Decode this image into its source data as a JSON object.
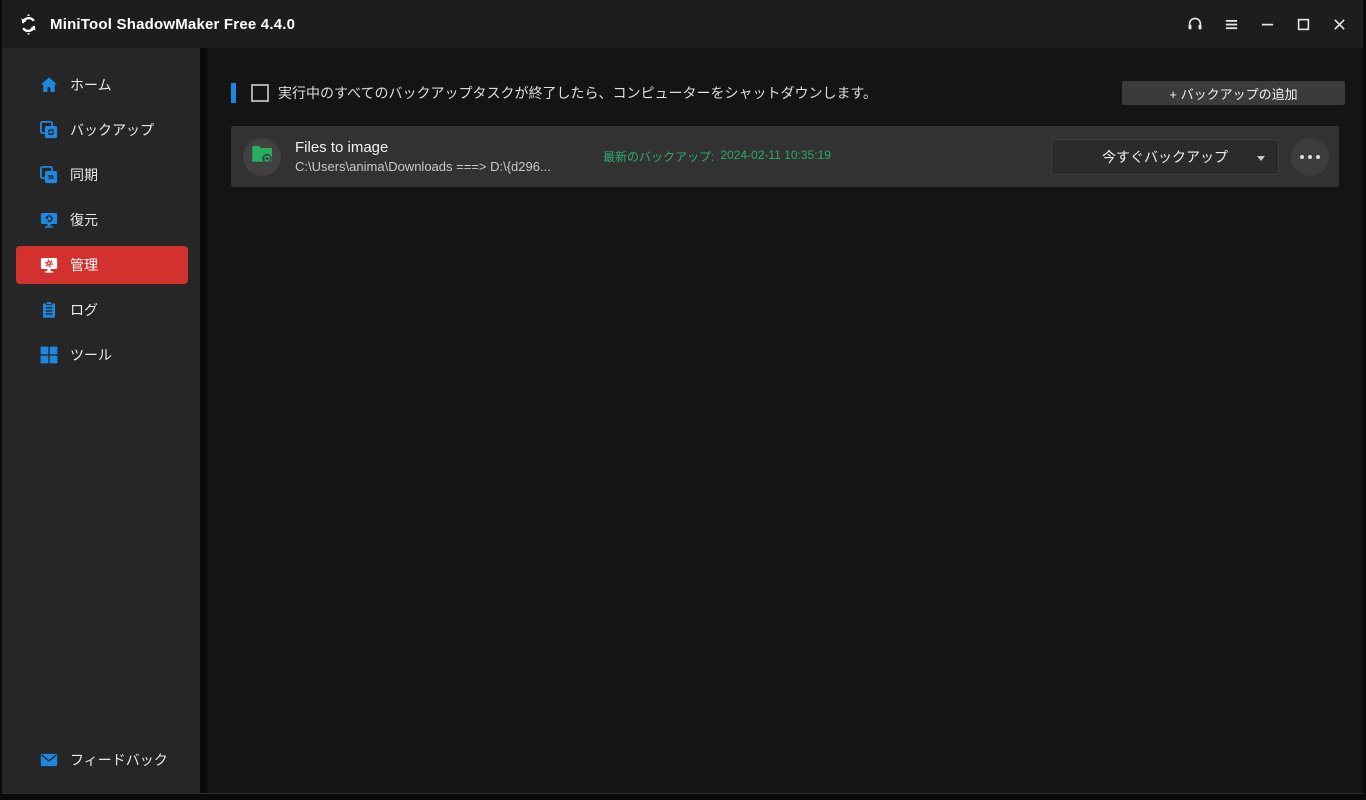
{
  "window": {
    "title": "MiniTool ShadowMaker Free 4.4.0",
    "controls": [
      {
        "name": "support-icon"
      },
      {
        "name": "menu-icon"
      },
      {
        "name": "minimize-icon"
      },
      {
        "name": "maximize-icon"
      },
      {
        "name": "close-icon"
      }
    ]
  },
  "colors": {
    "accent_blue": "#1b87e5",
    "icon_blue": "#1e87e0",
    "selected_red": "#d3312e",
    "success_green": "#27ae60",
    "card_bg": "#323232"
  },
  "sidebar": {
    "items": [
      {
        "label": "ホーム",
        "icon": "home-icon",
        "selected": false
      },
      {
        "label": "バックアップ",
        "icon": "backup-icon",
        "selected": false
      },
      {
        "label": "同期",
        "icon": "sync-icon",
        "selected": false
      },
      {
        "label": "復元",
        "icon": "restore-icon",
        "selected": false
      },
      {
        "label": "管理",
        "icon": "manage-icon",
        "selected": true
      },
      {
        "label": "ログ",
        "icon": "log-icon",
        "selected": false
      },
      {
        "label": "ツール",
        "icon": "tools-icon",
        "selected": false
      }
    ],
    "footer_item": {
      "label": "フィードバック",
      "icon": "feedback-icon"
    }
  },
  "header": {
    "shutdown_label": "実行中のすべてのバックアップタスクが終了したら、コンピューターをシャットダウンします。",
    "checkbox_checked": false,
    "add_backup_label": "+ バックアップの追加"
  },
  "task": {
    "name": "Files to image",
    "path": "C:\\Users\\anima\\Downloads ===> D:\\{d296...",
    "latest_label": "最新のバックアップ:",
    "latest_time": "2024-02-11 10:35:19",
    "backup_now_label": "今すぐバックアップ",
    "icon": "folder-backup-icon",
    "more_icon": "ellipsis-icon"
  }
}
